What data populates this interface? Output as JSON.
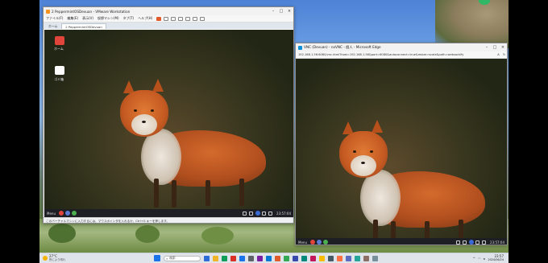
{
  "host": {
    "taskbar": {
      "weather_temp": "27°C",
      "weather_desc": "所により晴れ",
      "search_placeholder": "検索",
      "clock_time": "23:57",
      "clock_date": "2024/06/24",
      "app_colors": [
        "#2d6bd6",
        "#f0b429",
        "#0f9d58",
        "#d93025",
        "#1a73e8",
        "#5f6368",
        "#7b1fa2",
        "#0078d4",
        "#e25b2a",
        "#34a853",
        "#3949ab",
        "#00897b",
        "#c2185b",
        "#fbbc04",
        "#455a64",
        "#ff7043",
        "#5c6bc0",
        "#26a69a",
        "#8d6e63",
        "#78909c"
      ]
    }
  },
  "vmware": {
    "title": "2 PeppermintOSDevuan - VMware Workstation",
    "menu": [
      "ファイル(F)",
      "編集(E)",
      "表示(V)",
      "仮想マシン(M)",
      "タブ(T)",
      "ヘルプ(H)"
    ],
    "tabs": [
      "ホーム",
      "2 PeppermintOSDevuan"
    ],
    "status_text": "このバーチャルマシンに入力するには、マウスポインタを入れるか、Ctrl+G キーを押します。",
    "guest": {
      "icons": [
        {
          "label": "ホーム",
          "color": "#e0443a"
        },
        {
          "label": "ゴミ箱",
          "color": "#ffffff"
        }
      ],
      "taskbar_menu": "Menu",
      "taskbar_time": "23:57:04"
    }
  },
  "edge": {
    "title": "VNC (Devuan) - noVNC - 個人 - Microsoft Edge",
    "url": "192.168.1.56:6080/vnc.html?host=192.168.1.56&port=6080&autoconnect=true&resize=scale&path=websockify",
    "guest": {
      "taskbar_menu": "Menu",
      "taskbar_time": "23:57:04"
    }
  },
  "colors": {
    "vmware_icon": "#f7941d",
    "edge_icon": "#0c8fd6",
    "accent_red": "#e25a2a"
  }
}
